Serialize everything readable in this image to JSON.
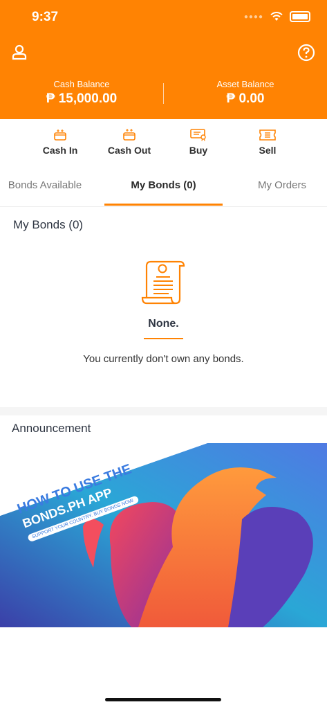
{
  "status": {
    "time": "9:37"
  },
  "header": {
    "cash_balance_label": "Cash Balance",
    "cash_balance_value": "₱ 15,000.00",
    "asset_balance_label": "Asset Balance",
    "asset_balance_value": "₱ 0.00"
  },
  "actions": [
    {
      "label": "Cash In",
      "icon": "wallet-in-icon"
    },
    {
      "label": "Cash Out",
      "icon": "wallet-out-icon"
    },
    {
      "label": "Buy",
      "icon": "certificate-icon"
    },
    {
      "label": "Sell",
      "icon": "ticket-icon"
    }
  ],
  "tabs": [
    {
      "label": "Bonds Available",
      "active": false
    },
    {
      "label": "My Bonds (0)",
      "active": true
    },
    {
      "label": "My Orders",
      "active": false
    }
  ],
  "main": {
    "section_title": "My Bonds (0)",
    "empty_title": "None.",
    "empty_message": "You currently don't own any bonds."
  },
  "announcement": {
    "title": "Announcement",
    "banner_line1": "HOW TO USE THE",
    "banner_line2": "BONDS.PH APP",
    "banner_line3": "SUPPORT YOUR COUNTRY. BUY BONDS NOW."
  },
  "colors": {
    "brand": "#FF8303",
    "text_dark": "#2e3542"
  }
}
